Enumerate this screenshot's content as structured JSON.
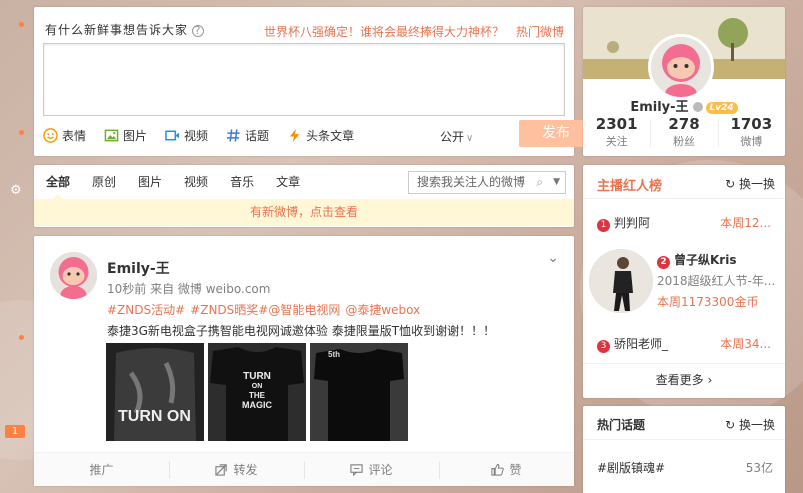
{
  "left_rail": {
    "badge": "1"
  },
  "publisher": {
    "prompt": "有什么新鲜事想告诉大家",
    "hot_topic": "世界杯八强确定！谁将会最终捧得大力神杯？",
    "hot_link": "热门微博",
    "tools": [
      {
        "label": "表情",
        "icon": "emoji-icon",
        "color": "#ff9900"
      },
      {
        "label": "图片",
        "icon": "image-icon",
        "color": "#6bb02f"
      },
      {
        "label": "视频",
        "icon": "video-icon",
        "color": "#2a8fd8"
      },
      {
        "label": "话题",
        "icon": "hashtag-icon",
        "color": "#3d7bd9"
      },
      {
        "label": "头条文章",
        "icon": "lightning-icon",
        "color": "#ff8c00"
      }
    ],
    "visibility": "公开",
    "send_label": "发布"
  },
  "tabs": {
    "items": [
      "全部",
      "原创",
      "图片",
      "视频",
      "音乐",
      "文章"
    ],
    "search_placeholder": "搜索我关注人的微博",
    "new_feed": "有新微博，点击查看"
  },
  "feed": {
    "author": "Emily-王",
    "time": "10秒前",
    "source": "来自 微博 weibo.com",
    "tags": [
      "#ZNDS活动#",
      "#ZNDS晒奖#@智能电视网",
      "@泰捷webox"
    ],
    "text": "泰捷3G新电视盒子携智能电视网诚邀体验 泰捷限量版T恤收到谢谢！！！",
    "image_texts": {
      "img1": "TURN ON",
      "img2": [
        "TURN",
        "ON",
        "THE",
        "MAGIC"
      ],
      "img3": "5th"
    },
    "actions": [
      "推广",
      "转发",
      "评论",
      "赞"
    ]
  },
  "profile": {
    "name": "Emily-王",
    "level": "Lv24",
    "stats": [
      {
        "num": "2301",
        "label": "关注"
      },
      {
        "num": "278",
        "label": "粉丝"
      },
      {
        "num": "1703",
        "label": "微博"
      }
    ]
  },
  "streamers": {
    "title": "主播红人榜",
    "refresh": "换一换",
    "first": {
      "rank": "1",
      "name": "判判阿",
      "week": "本周12..."
    },
    "second": {
      "rank": "2",
      "name": "曾子纵Kris",
      "sub": "2018超级红人节-年...",
      "week": "本周1173300金币"
    },
    "third": {
      "rank": "3",
      "name": "骄阳老师_",
      "week": "本周34..."
    },
    "more": "查看更多"
  },
  "topics": {
    "title": "热门话题",
    "refresh": "换一换",
    "items": [
      {
        "name": "#剧版镇魂#",
        "count": "53亿"
      }
    ]
  }
}
